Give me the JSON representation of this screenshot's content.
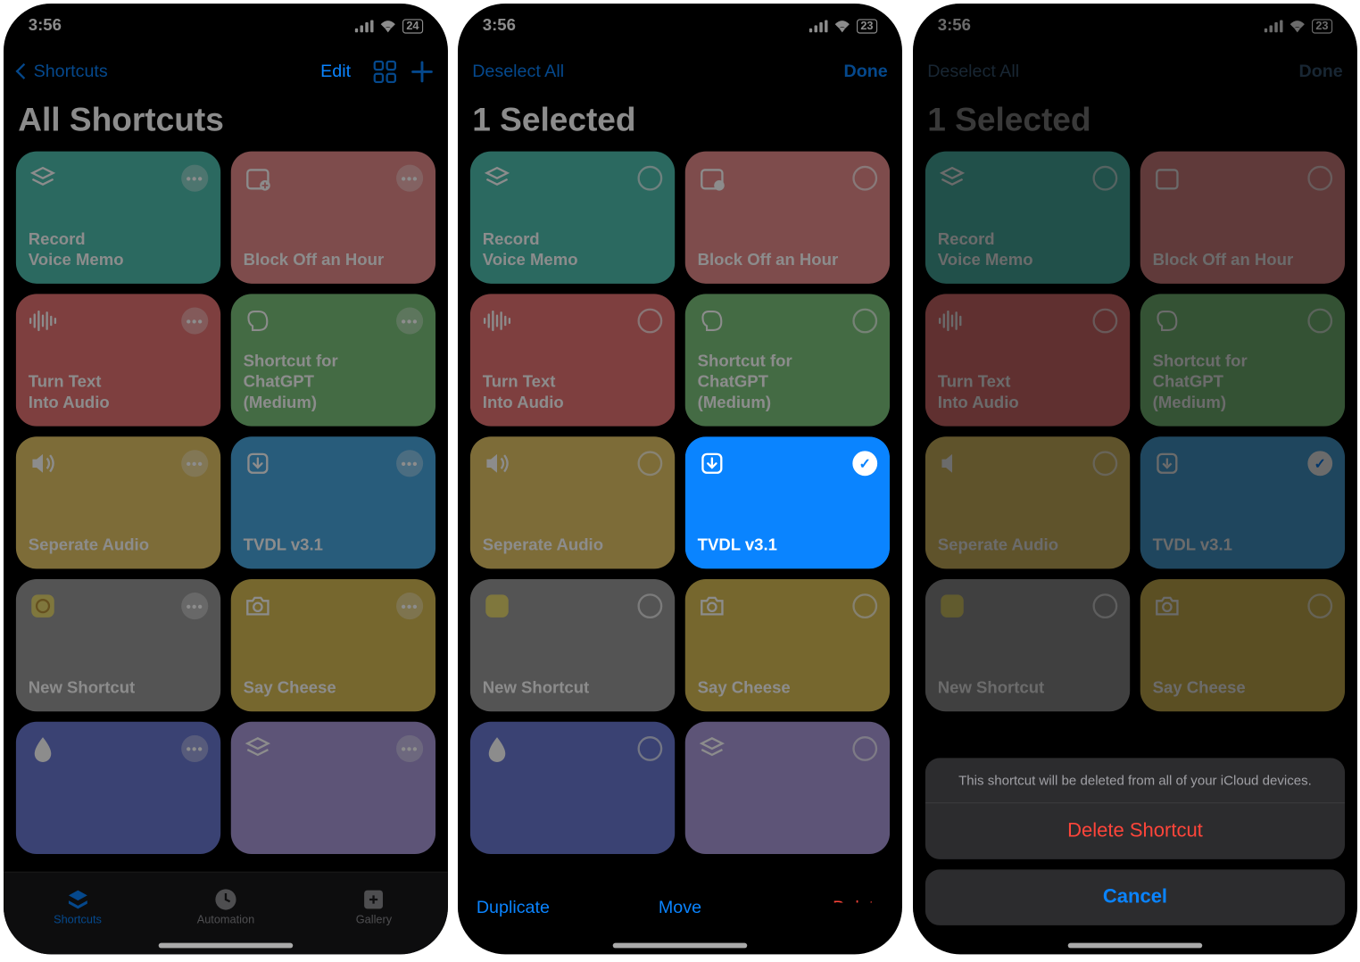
{
  "status": {
    "time": "3:56",
    "battery_a": "24",
    "battery_b": "23",
    "battery_c": "23"
  },
  "screenA": {
    "back_label": "Shortcuts",
    "edit_label": "Edit",
    "title": "All Shortcuts",
    "tabs": {
      "shortcuts": "Shortcuts",
      "automation": "Automation",
      "gallery": "Gallery"
    }
  },
  "screenB": {
    "deselect_label": "Deselect All",
    "done_label": "Done",
    "title": "1 Selected",
    "toolbar": {
      "duplicate": "Duplicate",
      "move": "Move",
      "delete": "Delete"
    }
  },
  "screenC": {
    "deselect_label": "Deselect All",
    "done_label": "Done",
    "title": "1 Selected",
    "sheet_message": "This shortcut will be deleted from all of your iCloud devices.",
    "delete_label": "Delete Shortcut",
    "cancel_label": "Cancel"
  },
  "shortcuts": {
    "record": "Record\nVoice Memo",
    "block": "Block Off an Hour",
    "turntext": "Turn Text\nInto Audio",
    "chatgpt": "Shortcut for\nChatGPT\n(Medium)",
    "seperate": "Seperate Audio",
    "tvdl": "TVDL v3.1",
    "newshortcut": "New Shortcut",
    "saycheese": "Say Cheese"
  }
}
